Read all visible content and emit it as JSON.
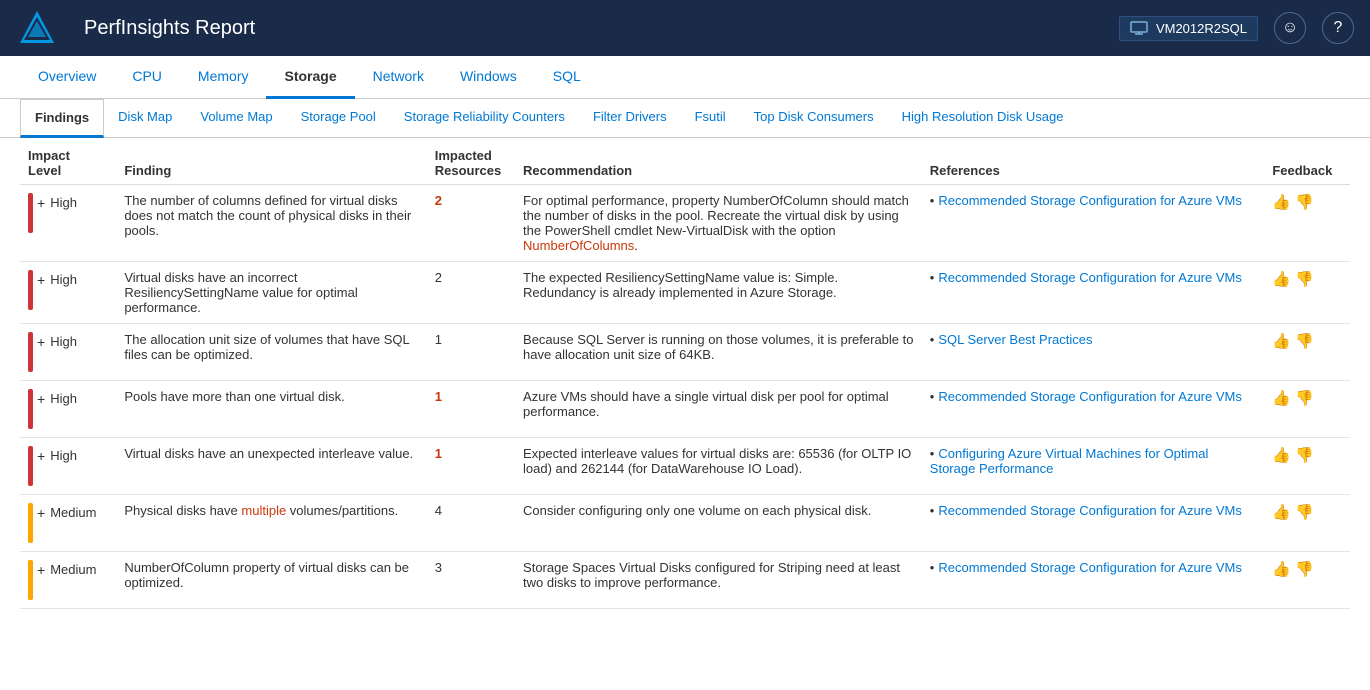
{
  "header": {
    "title": "PerfInsights Report",
    "vm_name": "VM2012R2SQL",
    "smile_icon": "☺",
    "help_icon": "?"
  },
  "top_tabs": [
    {
      "label": "Overview",
      "active": false
    },
    {
      "label": "CPU",
      "active": false
    },
    {
      "label": "Memory",
      "active": false
    },
    {
      "label": "Storage",
      "active": true
    },
    {
      "label": "Network",
      "active": false
    },
    {
      "label": "Windows",
      "active": false
    },
    {
      "label": "SQL",
      "active": false
    }
  ],
  "sub_tabs": [
    {
      "label": "Findings",
      "active": true
    },
    {
      "label": "Disk Map",
      "active": false
    },
    {
      "label": "Volume Map",
      "active": false
    },
    {
      "label": "Storage Pool",
      "active": false
    },
    {
      "label": "Storage Reliability Counters",
      "active": false
    },
    {
      "label": "Filter Drivers",
      "active": false
    },
    {
      "label": "Fsutil",
      "active": false
    },
    {
      "label": "Top Disk Consumers",
      "active": false
    },
    {
      "label": "High Resolution Disk Usage",
      "active": false
    }
  ],
  "table": {
    "columns": [
      {
        "label": "Impact\nLevel",
        "key": "impact_level"
      },
      {
        "label": "Finding",
        "key": "finding"
      },
      {
        "label": "Impacted\nResources",
        "key": "impacted"
      },
      {
        "label": "Recommendation",
        "key": "recommendation"
      },
      {
        "label": "References",
        "key": "references"
      },
      {
        "label": "Feedback",
        "key": "feedback"
      }
    ],
    "rows": [
      {
        "impact_level": "High",
        "impact_class": "high",
        "finding": "The number of columns defined for virtual disks does not match the count of physical disks in their pools.",
        "impacted": "2",
        "impacted_highlight": true,
        "recommendation": "For optimal performance, property NumberOfColumn should match the number of disks in the pool. Recreate the virtual disk by using the PowerShell cmdlet New-VirtualDisk with the option NumberOfColumns.",
        "rec_highlight": "NumberOfColumns",
        "references": [
          {
            "text": "Recommended Storage Configuration for Azure VMs",
            "url": "#"
          }
        ]
      },
      {
        "impact_level": "High",
        "impact_class": "high",
        "finding": "Virtual disks have an incorrect ResiliencySettingName value for optimal performance.",
        "impacted": "2",
        "impacted_highlight": false,
        "recommendation": "The expected ResiliencySettingName value is: Simple. Redundancy is already implemented in Azure Storage.",
        "rec_highlight": "",
        "references": [
          {
            "text": "Recommended Storage Configuration for Azure VMs",
            "url": "#"
          }
        ]
      },
      {
        "impact_level": "High",
        "impact_class": "high",
        "finding": "The allocation unit size of volumes that have SQL files can be optimized.",
        "impacted": "1",
        "impacted_highlight": false,
        "recommendation": "Because SQL Server is running on those volumes, it is preferable to have allocation unit size of 64KB.",
        "rec_highlight": "",
        "references": [
          {
            "text": "SQL Server Best Practices",
            "url": "#"
          }
        ]
      },
      {
        "impact_level": "High",
        "impact_class": "high",
        "finding": "Pools have more than one virtual disk.",
        "impacted": "1",
        "impacted_highlight": true,
        "recommendation": "Azure VMs should have a single virtual disk per pool for optimal performance.",
        "rec_highlight": "",
        "references": [
          {
            "text": "Recommended Storage Configuration for Azure VMs",
            "url": "#"
          }
        ]
      },
      {
        "impact_level": "High",
        "impact_class": "high",
        "finding": "Virtual disks have an unexpected interleave value.",
        "impacted": "1",
        "impacted_highlight": false,
        "recommendation": "Expected interleave values for virtual disks are: 65536 (for OLTP IO load) and 262144 (for DataWarehouse IO Load).",
        "rec_highlight": "",
        "references": [
          {
            "text": "Configuring Azure Virtual Machines for Optimal Storage Performance",
            "url": "#"
          }
        ]
      },
      {
        "impact_level": "Medium",
        "impact_class": "medium",
        "finding": "Physical disks have multiple volumes/partitions.",
        "impacted": "4",
        "impacted_highlight": false,
        "recommendation": "Consider configuring only one volume on each physical disk.",
        "rec_highlight": "",
        "references": [
          {
            "text": "Recommended Storage Configuration for Azure VMs",
            "url": "#"
          }
        ]
      },
      {
        "impact_level": "Medium",
        "impact_class": "medium",
        "finding": "NumberOfColumn property of virtual disks can be optimized.",
        "impacted": "3",
        "impacted_highlight": false,
        "recommendation": "Storage Spaces Virtual Disks configured for Striping need at least two disks to improve performance.",
        "rec_highlight": "",
        "references": [
          {
            "text": "Recommended Storage Configuration for Azure VMs",
            "url": "#"
          }
        ]
      }
    ]
  }
}
